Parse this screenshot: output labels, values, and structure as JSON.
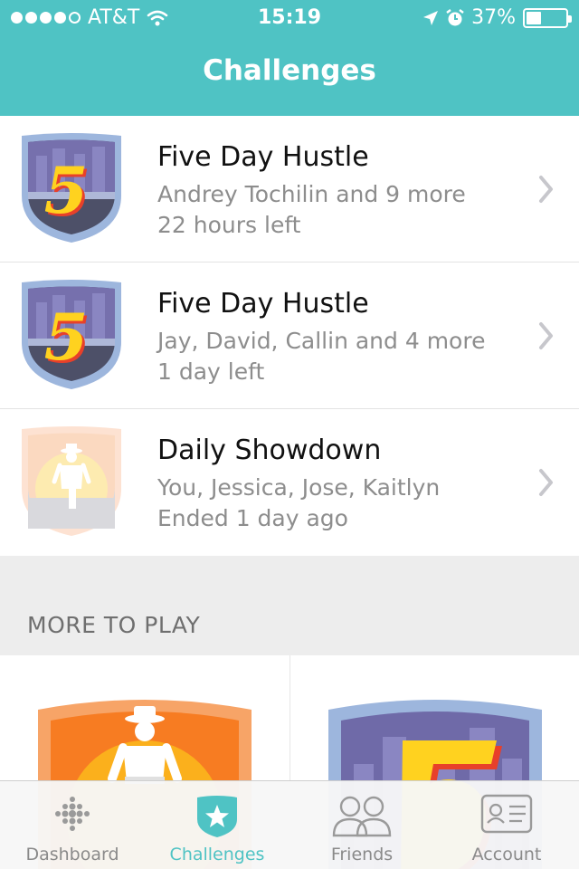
{
  "status_bar": {
    "carrier": "AT&T",
    "time": "15:19",
    "battery_percent": "37%",
    "battery_level": 0.37,
    "signal_bars_filled": 4,
    "signal_bars_total": 5
  },
  "header": {
    "title": "Challenges"
  },
  "challenges": [
    {
      "title": "Five Day Hustle",
      "participants": "Andrey Tochilin and 9 more",
      "time": "22 hours left",
      "badge": "five-day-hustle-badge"
    },
    {
      "title": "Five Day Hustle",
      "participants": "Jay, David, Callin and 4 more",
      "time": "1 day left",
      "badge": "five-day-hustle-badge"
    },
    {
      "title": "Daily Showdown",
      "participants": "You, Jessica, Jose, Kaitlyn",
      "time": "Ended 1 day ago",
      "badge": "daily-showdown-badge-faded"
    }
  ],
  "more_to_play": {
    "label": "MORE TO PLAY",
    "items": [
      "daily-showdown-badge",
      "five-day-hustle-badge"
    ]
  },
  "tabs": [
    {
      "label": "Dashboard",
      "icon": "fitbit-dots-icon",
      "active": false
    },
    {
      "label": "Challenges",
      "icon": "star-shield-icon",
      "active": true
    },
    {
      "label": "Friends",
      "icon": "people-icon",
      "active": false
    },
    {
      "label": "Account",
      "icon": "id-card-icon",
      "active": false
    }
  ],
  "colors": {
    "accent": "#4fc3c4",
    "badge_purple": "#6f6aa8",
    "badge_rim": "#9db6dd",
    "five_yellow": "#ffd21f",
    "five_red": "#e8402a",
    "showdown_orange": "#f77c22"
  }
}
